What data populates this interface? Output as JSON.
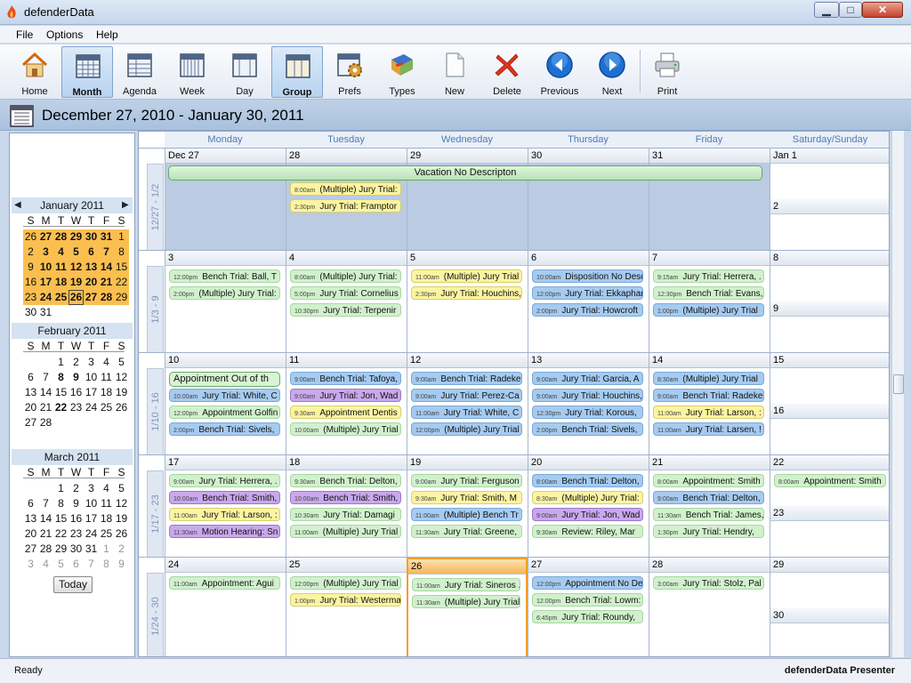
{
  "window": {
    "title": "defenderData",
    "min": "▁",
    "max": "□",
    "close": "✕"
  },
  "menu": {
    "file": "File",
    "options": "Options",
    "help": "Help"
  },
  "toolbar": [
    {
      "label": "Home",
      "icon": "home-icon"
    },
    {
      "label": "Month",
      "icon": "month-calendar-icon",
      "active": true
    },
    {
      "label": "Agenda",
      "icon": "agenda-icon"
    },
    {
      "label": "Week",
      "icon": "week-calendar-icon"
    },
    {
      "label": "Day",
      "icon": "day-calendar-icon"
    },
    {
      "label": "Group",
      "icon": "group-calendar-icon",
      "active": true
    },
    {
      "label": "Prefs",
      "icon": "prefs-gear-icon"
    },
    {
      "label": "Types",
      "icon": "types-book-icon"
    },
    {
      "label": "New",
      "icon": "new-page-icon"
    },
    {
      "label": "Delete",
      "icon": "delete-x-icon"
    },
    {
      "label": "Previous",
      "icon": "previous-arrow-icon"
    },
    {
      "label": "Next",
      "icon": "next-arrow-icon"
    },
    {
      "label": "Print",
      "icon": "printer-icon"
    }
  ],
  "range_title": "December 27, 2010 - January 30, 2011",
  "mini_calendars": [
    {
      "title": "January 2011",
      "dow": [
        "S",
        "M",
        "T",
        "W",
        "T",
        "F",
        "S"
      ],
      "rows": [
        [
          "26",
          "27",
          "28",
          "29",
          "30",
          "31",
          "1"
        ],
        [
          "2",
          "3",
          "4",
          "5",
          "6",
          "7",
          "8"
        ],
        [
          "9",
          "10",
          "11",
          "12",
          "13",
          "14",
          "15"
        ],
        [
          "16",
          "17",
          "18",
          "19",
          "20",
          "21",
          "22"
        ],
        [
          "23",
          "24",
          "25",
          "26",
          "27",
          "28",
          "29"
        ],
        [
          "30",
          "31",
          "",
          "",
          "",
          "",
          ""
        ]
      ]
    },
    {
      "title": "February 2011",
      "dow": [
        "S",
        "M",
        "T",
        "W",
        "T",
        "F",
        "S"
      ],
      "rows": [
        [
          "",
          "",
          "1",
          "2",
          "3",
          "4",
          "5"
        ],
        [
          "6",
          "7",
          "8",
          "9",
          "10",
          "11",
          "12"
        ],
        [
          "13",
          "14",
          "15",
          "16",
          "17",
          "18",
          "19"
        ],
        [
          "20",
          "21",
          "22",
          "23",
          "24",
          "25",
          "26"
        ],
        [
          "27",
          "28",
          "",
          "",
          "",
          "",
          ""
        ]
      ]
    },
    {
      "title": "March 2011",
      "dow": [
        "S",
        "M",
        "T",
        "W",
        "T",
        "F",
        "S"
      ],
      "rows": [
        [
          "",
          "",
          "1",
          "2",
          "3",
          "4",
          "5"
        ],
        [
          "6",
          "7",
          "8",
          "9",
          "10",
          "11",
          "12"
        ],
        [
          "13",
          "14",
          "15",
          "16",
          "17",
          "18",
          "19"
        ],
        [
          "20",
          "21",
          "22",
          "23",
          "24",
          "25",
          "26"
        ],
        [
          "27",
          "28",
          "29",
          "30",
          "31",
          "1",
          "2"
        ],
        [
          "3",
          "4",
          "5",
          "6",
          "7",
          "8",
          "9"
        ]
      ]
    }
  ],
  "today_button": "Today",
  "day_headers": [
    "Monday",
    "Tuesday",
    "Wednesday",
    "Thursday",
    "Friday",
    "Saturday/Sunday"
  ],
  "weeks": [
    {
      "label": "12/27 - 1/2",
      "days": [
        {
          "num": "Dec 27",
          "events": []
        },
        {
          "num": "28",
          "events": [
            {
              "time": "8:00am",
              "text": "(Multiple) Jury Trial:",
              "color": "yellow"
            },
            {
              "time": "2:30pm",
              "text": "Jury Trial: Framptor",
              "color": "yellow"
            }
          ]
        },
        {
          "num": "29",
          "events": []
        },
        {
          "num": "30",
          "events": []
        },
        {
          "num": "31",
          "events": []
        },
        {
          "num": "Jan 1",
          "events": [],
          "num2": "2",
          "events2": []
        }
      ]
    },
    {
      "label": "1/3 - 9",
      "days": [
        {
          "num": "3",
          "events": [
            {
              "time": "12:00pm",
              "text": "Bench Trial: Ball, T",
              "color": "green"
            },
            {
              "time": "2:00pm",
              "text": "(Multiple) Jury Trial:",
              "color": "green"
            }
          ]
        },
        {
          "num": "4",
          "events": [
            {
              "time": "8:00am",
              "text": "(Multiple) Jury Trial:",
              "color": "green"
            },
            {
              "time": "5:00pm",
              "text": "Jury Trial: Cornelius",
              "color": "green"
            },
            {
              "time": "10:30pm",
              "text": "Jury Trial: Terpenir",
              "color": "green"
            }
          ]
        },
        {
          "num": "5",
          "events": [
            {
              "time": "11:00am",
              "text": "(Multiple) Jury Trial",
              "color": "yellow"
            },
            {
              "time": "2:30pm",
              "text": "Jury Trial: Houchins,",
              "color": "yellow"
            }
          ]
        },
        {
          "num": "6",
          "events": [
            {
              "time": "10:00am",
              "text": "Disposition No Desc",
              "color": "blue"
            },
            {
              "time": "12:00pm",
              "text": "Jury Trial: Ekkaphar",
              "color": "blue"
            },
            {
              "time": "2:00pm",
              "text": "Jury Trial: Howcroft",
              "color": "blue"
            }
          ]
        },
        {
          "num": "7",
          "events": [
            {
              "time": "9:15am",
              "text": "Jury Trial: Herrera, .",
              "color": "green"
            },
            {
              "time": "12:30pm",
              "text": "Bench Trial: Evans,",
              "color": "green"
            },
            {
              "time": "1:00pm",
              "text": "(Multiple) Jury Trial",
              "color": "blue"
            }
          ]
        },
        {
          "num": "8",
          "events": [],
          "num2": "9",
          "events2": []
        }
      ]
    },
    {
      "label": "1/10 - 16",
      "days": [
        {
          "num": "10",
          "events": [
            {
              "time": "",
              "text": "Appointment Out of th",
              "color": "big"
            },
            {
              "time": "10:00am",
              "text": "Jury Trial: White, C",
              "color": "blue"
            },
            {
              "time": "12:00pm",
              "text": "Appointment Golfin",
              "color": "green"
            },
            {
              "time": "2:00pm",
              "text": "Bench Trial: Sivels,",
              "color": "blue"
            }
          ]
        },
        {
          "num": "11",
          "events": [
            {
              "time": "9:00am",
              "text": "Bench Trial: Tafoya,",
              "color": "blue"
            },
            {
              "time": "9:00am",
              "text": "Jury Trial: Jon, Wad",
              "color": "purple"
            },
            {
              "time": "9:30am",
              "text": "Appointment Dentis",
              "color": "yellow"
            },
            {
              "time": "10:00am",
              "text": "(Multiple) Jury Trial",
              "color": "green"
            }
          ]
        },
        {
          "num": "12",
          "events": [
            {
              "time": "9:00am",
              "text": "Bench Trial: Radeke",
              "color": "blue"
            },
            {
              "time": "9:00am",
              "text": "Jury Trial: Perez-Ca",
              "color": "blue"
            },
            {
              "time": "11:00am",
              "text": "Jury Trial: White, C",
              "color": "blue"
            },
            {
              "time": "12:00pm",
              "text": "(Multiple) Jury Trial",
              "color": "blue"
            }
          ]
        },
        {
          "num": "13",
          "events": [
            {
              "time": "9:00am",
              "text": "Jury Trial: Garcia, A",
              "color": "blue"
            },
            {
              "time": "9:00am",
              "text": "Jury Trial: Houchins,",
              "color": "blue"
            },
            {
              "time": "12:30pm",
              "text": "Jury Trial: Korous,",
              "color": "blue"
            },
            {
              "time": "2:00pm",
              "text": "Bench Trial: Sivels,",
              "color": "blue"
            }
          ]
        },
        {
          "num": "14",
          "events": [
            {
              "time": "8:30am",
              "text": "(Multiple) Jury Trial",
              "color": "blue"
            },
            {
              "time": "9:00am",
              "text": "Bench Trial: Radeke",
              "color": "blue"
            },
            {
              "time": "11:00am",
              "text": "Jury Trial: Larson, :",
              "color": "yellow"
            },
            {
              "time": "11:00am",
              "text": "Jury Trial: Larsen, !",
              "color": "blue"
            }
          ]
        },
        {
          "num": "15",
          "events": [],
          "num2": "16",
          "events2": []
        }
      ]
    },
    {
      "label": "1/17 - 23",
      "days": [
        {
          "num": "17",
          "events": [
            {
              "time": "9:00am",
              "text": "Jury Trial: Herrera, .",
              "color": "green"
            },
            {
              "time": "10:00am",
              "text": "Bench Trial: Smith,",
              "color": "purple"
            },
            {
              "time": "11:00am",
              "text": "Jury Trial: Larson, :",
              "color": "yellow"
            },
            {
              "time": "11:30am",
              "text": "Motion Hearing: Sn",
              "color": "purple"
            }
          ]
        },
        {
          "num": "18",
          "events": [
            {
              "time": "9:30am",
              "text": "Bench Trial: Delton,",
              "color": "green"
            },
            {
              "time": "10:00am",
              "text": "Bench Trial: Smith,",
              "color": "purple"
            },
            {
              "time": "10:30am",
              "text": "Jury Trial: Damagi",
              "color": "green"
            },
            {
              "time": "11:00am",
              "text": "(Multiple) Jury Trial",
              "color": "green"
            }
          ]
        },
        {
          "num": "19",
          "events": [
            {
              "time": "9:00am",
              "text": "Jury Trial: Ferguson",
              "color": "green"
            },
            {
              "time": "9:30am",
              "text": "Jury Trial: Smith, M",
              "color": "yellow"
            },
            {
              "time": "11:00am",
              "text": "(Multiple) Bench Tr",
              "color": "blue"
            },
            {
              "time": "11:30am",
              "text": "Jury Trial: Greene,",
              "color": "green"
            }
          ]
        },
        {
          "num": "20",
          "events": [
            {
              "time": "8:00am",
              "text": "Bench Trial: Delton,",
              "color": "blue"
            },
            {
              "time": "8:30am",
              "text": "(Multiple) Jury Trial:",
              "color": "yellow"
            },
            {
              "time": "9:00am",
              "text": "Jury Trial: Jon, Wad",
              "color": "purple"
            },
            {
              "time": "9:30am",
              "text": "Review: Riley, Mar",
              "color": "green"
            }
          ]
        },
        {
          "num": "21",
          "events": [
            {
              "time": "8:00am",
              "text": "Appointment: Smith",
              "color": "green"
            },
            {
              "time": "9:00am",
              "text": "Bench Trial: Delton,",
              "color": "blue"
            },
            {
              "time": "11:30am",
              "text": "Bench Trial: James,",
              "color": "green"
            },
            {
              "time": "1:30pm",
              "text": "Jury Trial: Hendry,",
              "color": "green"
            }
          ]
        },
        {
          "num": "22",
          "events": [
            {
              "time": "8:00am",
              "text": "Appointment: Smith",
              "color": "green"
            }
          ],
          "num2": "23",
          "events2": []
        }
      ]
    },
    {
      "label": "1/24 - 30",
      "days": [
        {
          "num": "24",
          "events": [
            {
              "time": "11:00am",
              "text": "Appointment: Agui",
              "color": "green"
            }
          ]
        },
        {
          "num": "25",
          "events": [
            {
              "time": "12:00pm",
              "text": "(Multiple) Jury Trial",
              "color": "green"
            },
            {
              "time": "1:00pm",
              "text": "Jury Trial: Westerma",
              "color": "yellow"
            }
          ]
        },
        {
          "num": "26",
          "today": true,
          "events": [
            {
              "time": "11:00am",
              "text": "Jury Trial: Sineros .",
              "color": "green"
            },
            {
              "time": "11:30am",
              "text": "(Multiple) Jury Trial",
              "color": "green"
            }
          ]
        },
        {
          "num": "27",
          "events": [
            {
              "time": "12:00pm",
              "text": "Appointment No De",
              "color": "blue"
            },
            {
              "time": "12:00pm",
              "text": "Bench Trial: Lowm:",
              "color": "green"
            },
            {
              "time": "6:45pm",
              "text": "Jury Trial: Roundy,",
              "color": "green"
            }
          ]
        },
        {
          "num": "28",
          "events": [
            {
              "time": "3:00am",
              "text": "Jury Trial: Stolz, Pal",
              "color": "green"
            }
          ]
        },
        {
          "num": "29",
          "events": [],
          "num2": "30",
          "events2": []
        }
      ]
    }
  ],
  "vacation_event": "Vacation No Descripton",
  "status": {
    "left": "Ready",
    "right": "defenderData Presenter"
  }
}
